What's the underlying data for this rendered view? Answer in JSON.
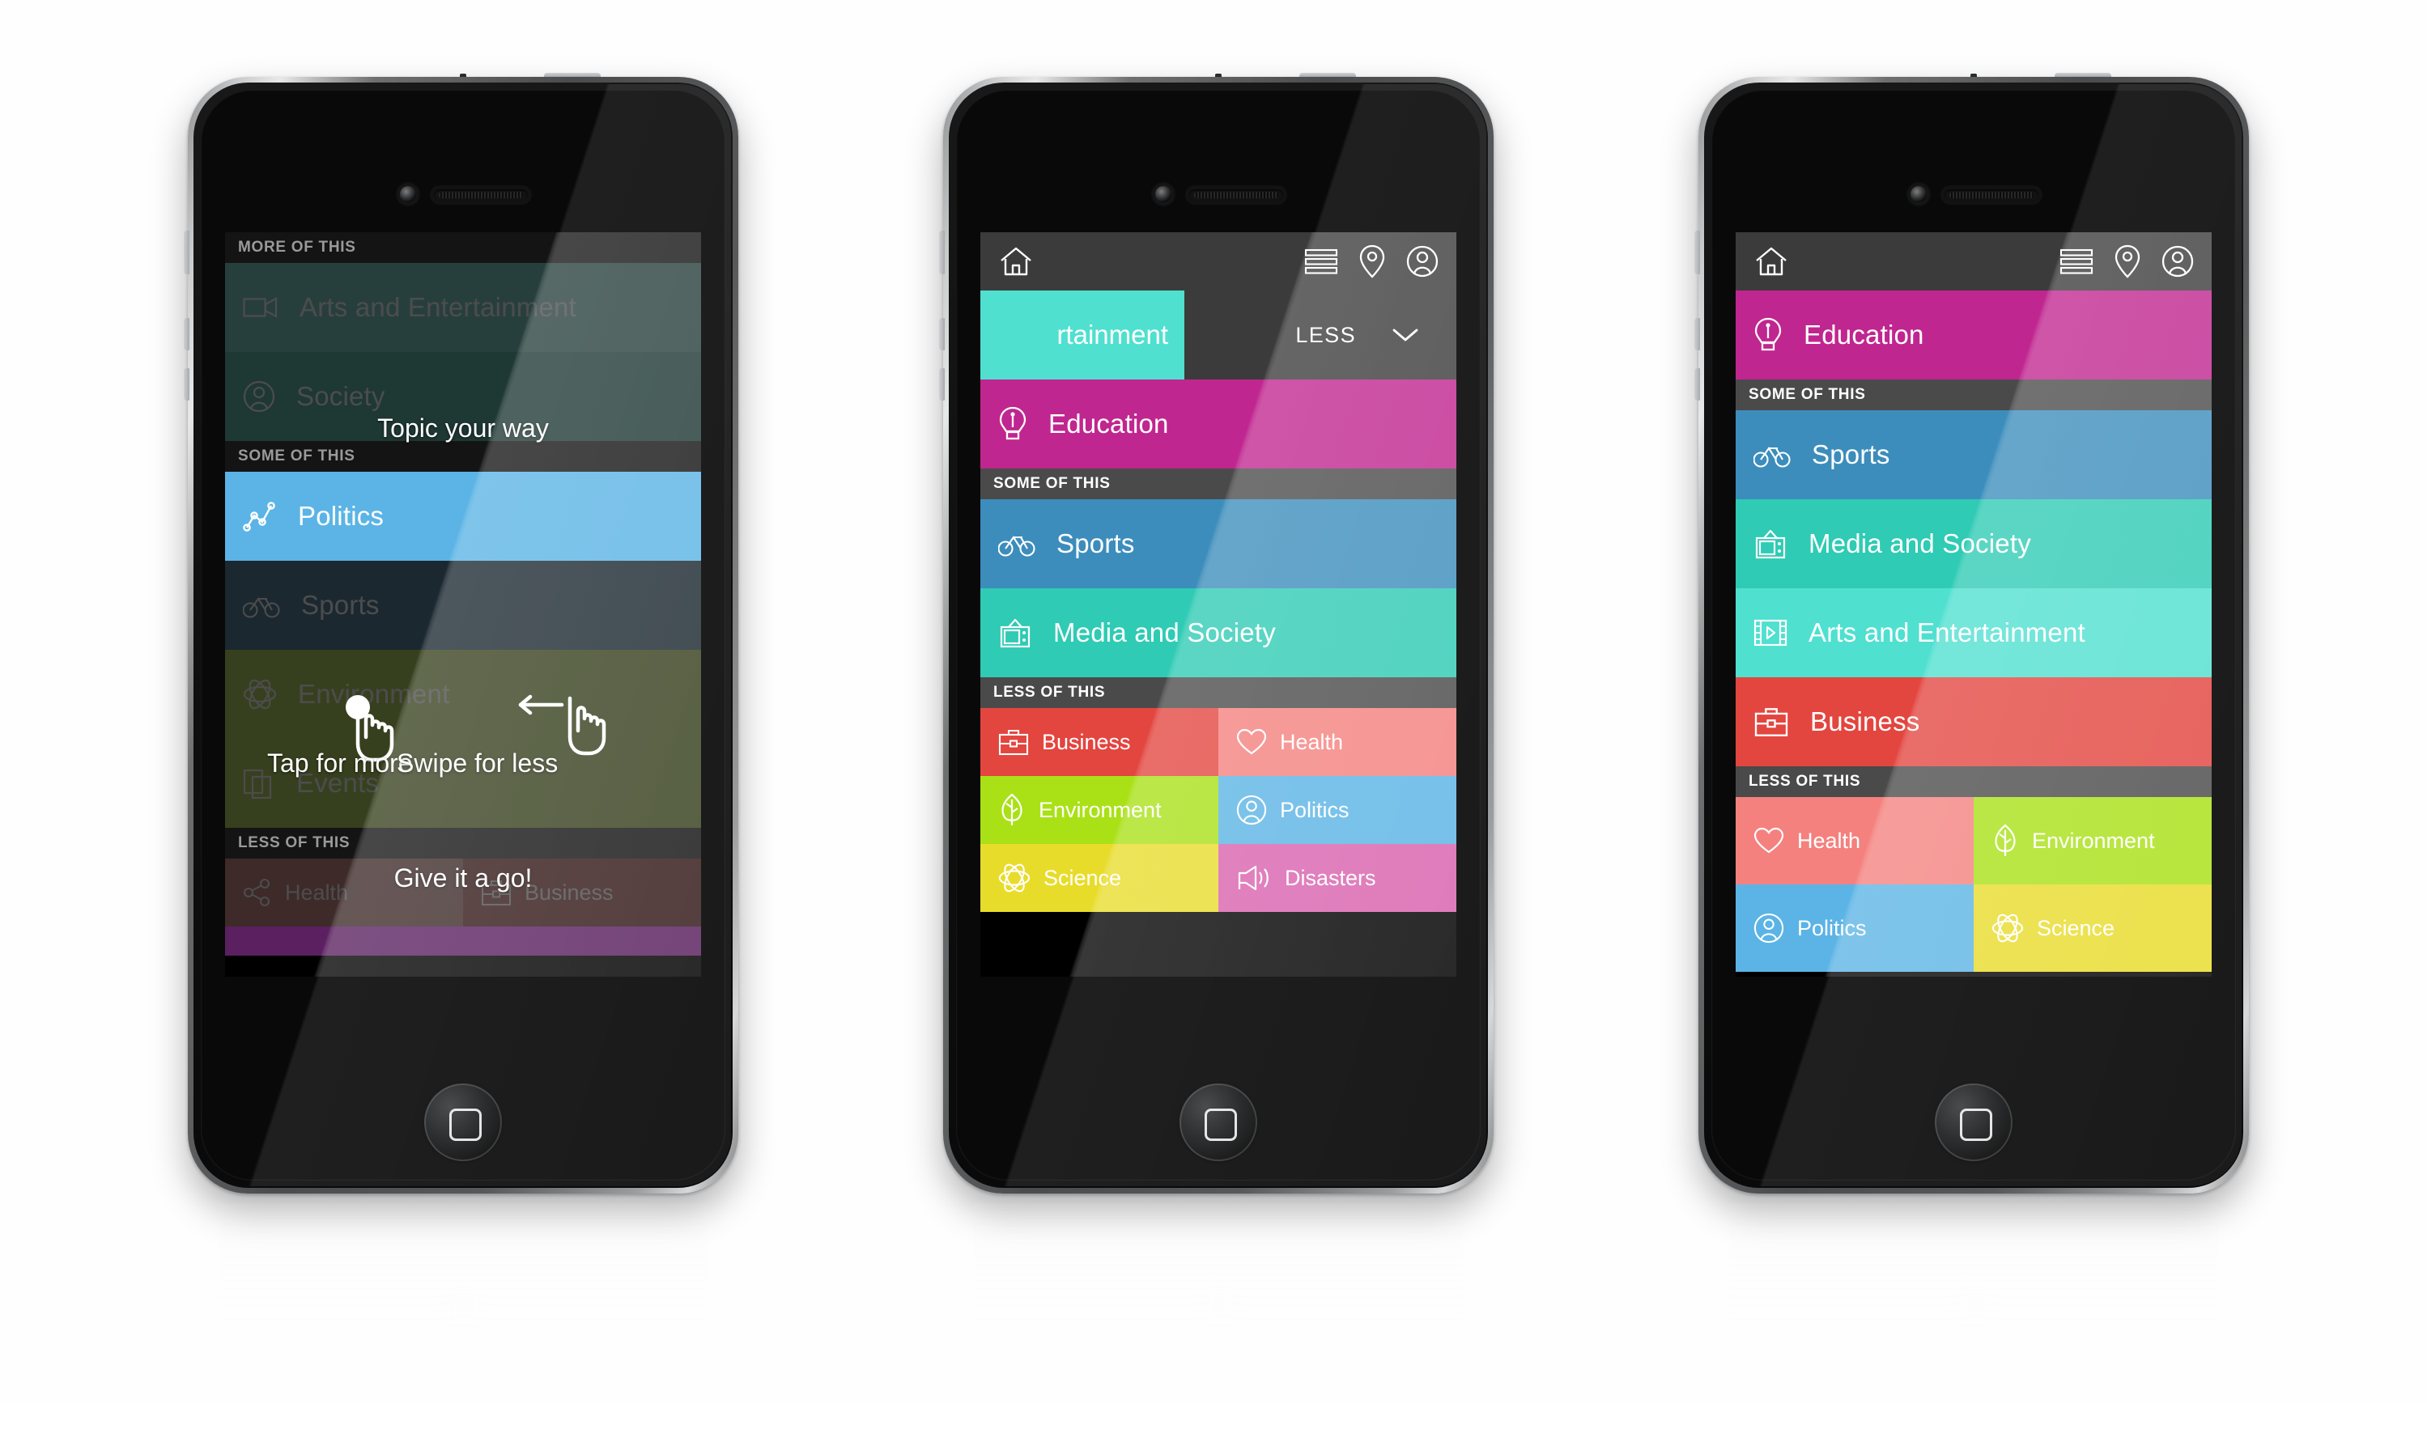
{
  "app": {
    "topbar": {
      "home_icon": "home-icon",
      "list_icon": "list-icon",
      "location_icon": "location-pin-icon",
      "profile_icon": "profile-icon"
    },
    "section_more": "MORE OF THIS",
    "section_some": "SOME OF THIS",
    "section_less": "LESS OF THIS",
    "swipe_action_label": "LESS",
    "swipe_chevron_icon": "chevron-down-icon"
  },
  "colors": {
    "education": "#C0268F",
    "sports": "#3C8DBC",
    "media_society": "#2FCBB4",
    "arts_entertainment": "#4FE0D0",
    "business": "#E3453F",
    "health": "#F4817E",
    "environment": "#A9E116",
    "politics": "#5BB4E5",
    "science": "#E8DC2B",
    "disasters": "#D962AE",
    "topbar": "#3B3B3B",
    "section": "#4A4A4A"
  },
  "phone1": {
    "name": "onboarding-tutorial-screen",
    "sections": [
      {
        "header": "MORE OF THIS",
        "rows": [
          {
            "label": "Arts and Entertainment",
            "icon": "video-camera-icon",
            "color": "#4FE0D0",
            "state": "dimmed"
          },
          {
            "label": "Society",
            "icon": "profile-icon",
            "color": "#2FCBB4",
            "state": "dimmed"
          }
        ]
      },
      {
        "header": "SOME OF THIS",
        "rows": [
          {
            "label": "Politics",
            "icon": "line-chart-icon",
            "color": "#5BB4E5",
            "state": "highlighted"
          },
          {
            "label": "Sports",
            "icon": "bicycle-icon",
            "color": "#3C8DBC",
            "state": "dimmed"
          },
          {
            "label": "Environment",
            "icon": "atom-icon",
            "color": "#A9E116",
            "state": "dimmed"
          },
          {
            "label": "Events",
            "icon": "pages-icon",
            "color": "#A9E116",
            "state": "dimmed"
          }
        ]
      },
      {
        "header": "LESS OF THIS",
        "cells": [
          {
            "label": "Health",
            "icon": "share-icon",
            "color": "#F4817E",
            "state": "dimmed"
          },
          {
            "label": "Business",
            "icon": "briefcase-icon",
            "color": "#E3453F",
            "state": "dimmed"
          }
        ]
      }
    ],
    "overlays": {
      "title": "Topic your way",
      "tap_hint": "Tap for more",
      "swipe_hint": "Swipe for less",
      "cta": "Give it a go!",
      "tap_icon": "tap-hand-icon",
      "swipe_icon": "swipe-hand-left-icon"
    }
  },
  "phone2": {
    "name": "swipe-in-progress-screen",
    "swiped_row": {
      "label_visible": "rtainment",
      "full_label": "Arts and Entertainment",
      "color": "#4FE0D0",
      "reveal_label": "LESS"
    },
    "sections": [
      {
        "header": null,
        "rows": [
          {
            "label": "Education",
            "icon": "lightbulb-icon",
            "color": "#C0268F"
          }
        ]
      },
      {
        "header": "SOME OF THIS",
        "rows": [
          {
            "label": "Sports",
            "icon": "bicycle-icon",
            "color": "#3C8DBC"
          },
          {
            "label": "Media and Society",
            "icon": "television-icon",
            "color": "#2FCBB4"
          }
        ]
      },
      {
        "header": "LESS OF THIS",
        "cells": [
          {
            "label": "Business",
            "icon": "briefcase-icon",
            "color": "#E3453F"
          },
          {
            "label": "Health",
            "icon": "heart-icon",
            "color": "#F4817E"
          },
          {
            "label": "Environment",
            "icon": "leaf-icon",
            "color": "#A9E116"
          },
          {
            "label": "Politics",
            "icon": "profile-icon",
            "color": "#5BB4E5"
          },
          {
            "label": "Science",
            "icon": "atom-icon",
            "color": "#E8DC2B"
          },
          {
            "label": "Disasters",
            "icon": "megaphone-icon",
            "color": "#D962AE"
          }
        ]
      }
    ]
  },
  "phone3": {
    "name": "topics-list-screen",
    "sections": [
      {
        "header": null,
        "rows": [
          {
            "label": "Education",
            "icon": "lightbulb-icon",
            "color": "#C0268F"
          }
        ]
      },
      {
        "header": "SOME OF THIS",
        "rows": [
          {
            "label": "Sports",
            "icon": "bicycle-icon",
            "color": "#3C8DBC"
          },
          {
            "label": "Media and Society",
            "icon": "television-icon",
            "color": "#2FCBB4"
          },
          {
            "label": "Arts and Entertainment",
            "icon": "film-icon",
            "color": "#4FE0D0"
          },
          {
            "label": "Business",
            "icon": "briefcase-icon",
            "color": "#E3453F"
          }
        ]
      },
      {
        "header": "LESS OF THIS",
        "cells": [
          {
            "label": "Health",
            "icon": "heart-icon",
            "color": "#F4817E"
          },
          {
            "label": "Environment",
            "icon": "leaf-icon",
            "color": "#A9E116"
          },
          {
            "label": "Politics",
            "icon": "profile-icon",
            "color": "#5BB4E5"
          },
          {
            "label": "Science",
            "icon": "atom-icon",
            "color": "#E8DC2B"
          }
        ]
      }
    ]
  }
}
